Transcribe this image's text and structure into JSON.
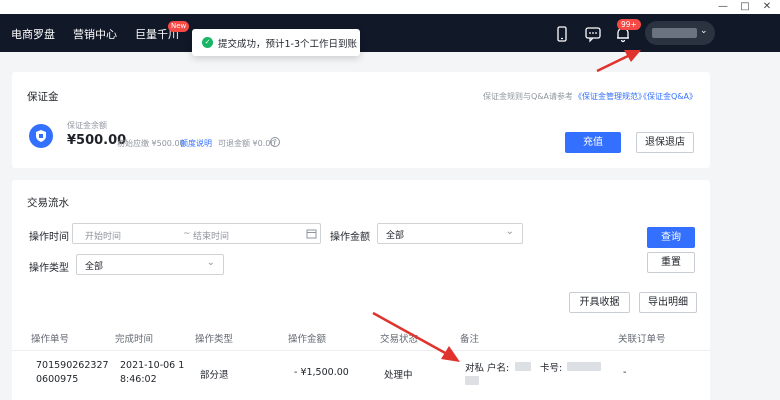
{
  "window": {
    "minimize": "—",
    "maximize": "□",
    "close": "✕"
  },
  "nav": {
    "items": [
      "电商罗盘",
      "营销中心",
      "巨量千川"
    ],
    "new_badge": "New",
    "bell_badge": "99+",
    "icons": [
      "phone-icon",
      "message-icon",
      "bell-icon"
    ]
  },
  "toast": {
    "icon": "check-circle-icon",
    "text": "提交成功，预计1-3个工作日到账"
  },
  "deposit": {
    "title": "保证金",
    "rules_text": "保证金规则与Q&A请参考",
    "link_management": "《保证金管理规范》",
    "link_qa": "《保证金Q&A》",
    "balance_label": "保证金余额",
    "balance_value": "¥500.00",
    "initial_text": "初始应缴 ¥500.00",
    "quota_link": "额度说明",
    "withdrawable_text": "可退金额 ¥0.00",
    "help_icon": "?",
    "recharge_button": "充值",
    "refund_button": "退保退店"
  },
  "flow": {
    "title": "交易流水",
    "time_label": "操作时间",
    "start_placeholder": "开始时间",
    "end_placeholder": "结束时间",
    "range_sep": "~",
    "amount_label": "操作金额",
    "amount_value": "全部",
    "type_label": "操作类型",
    "type_value": "全部",
    "query_button": "查询",
    "reset_button": "重置",
    "receipt_button": "开具收据",
    "export_button": "导出明细",
    "columns": [
      "操作单号",
      "完成时间",
      "操作类型",
      "操作金额",
      "交易状态",
      "备注",
      "关联订单号"
    ],
    "rows": [
      {
        "order_no_1": "701590262327",
        "order_no_2": "0600975",
        "time_1": "2021-10-06 1",
        "time_2": "8:46:02",
        "type": "部分退",
        "amount": "- ¥1,500.00",
        "status": "处理中",
        "remark": "对私  户名:",
        "remark_card": "卡号:",
        "related": "-"
      }
    ]
  }
}
